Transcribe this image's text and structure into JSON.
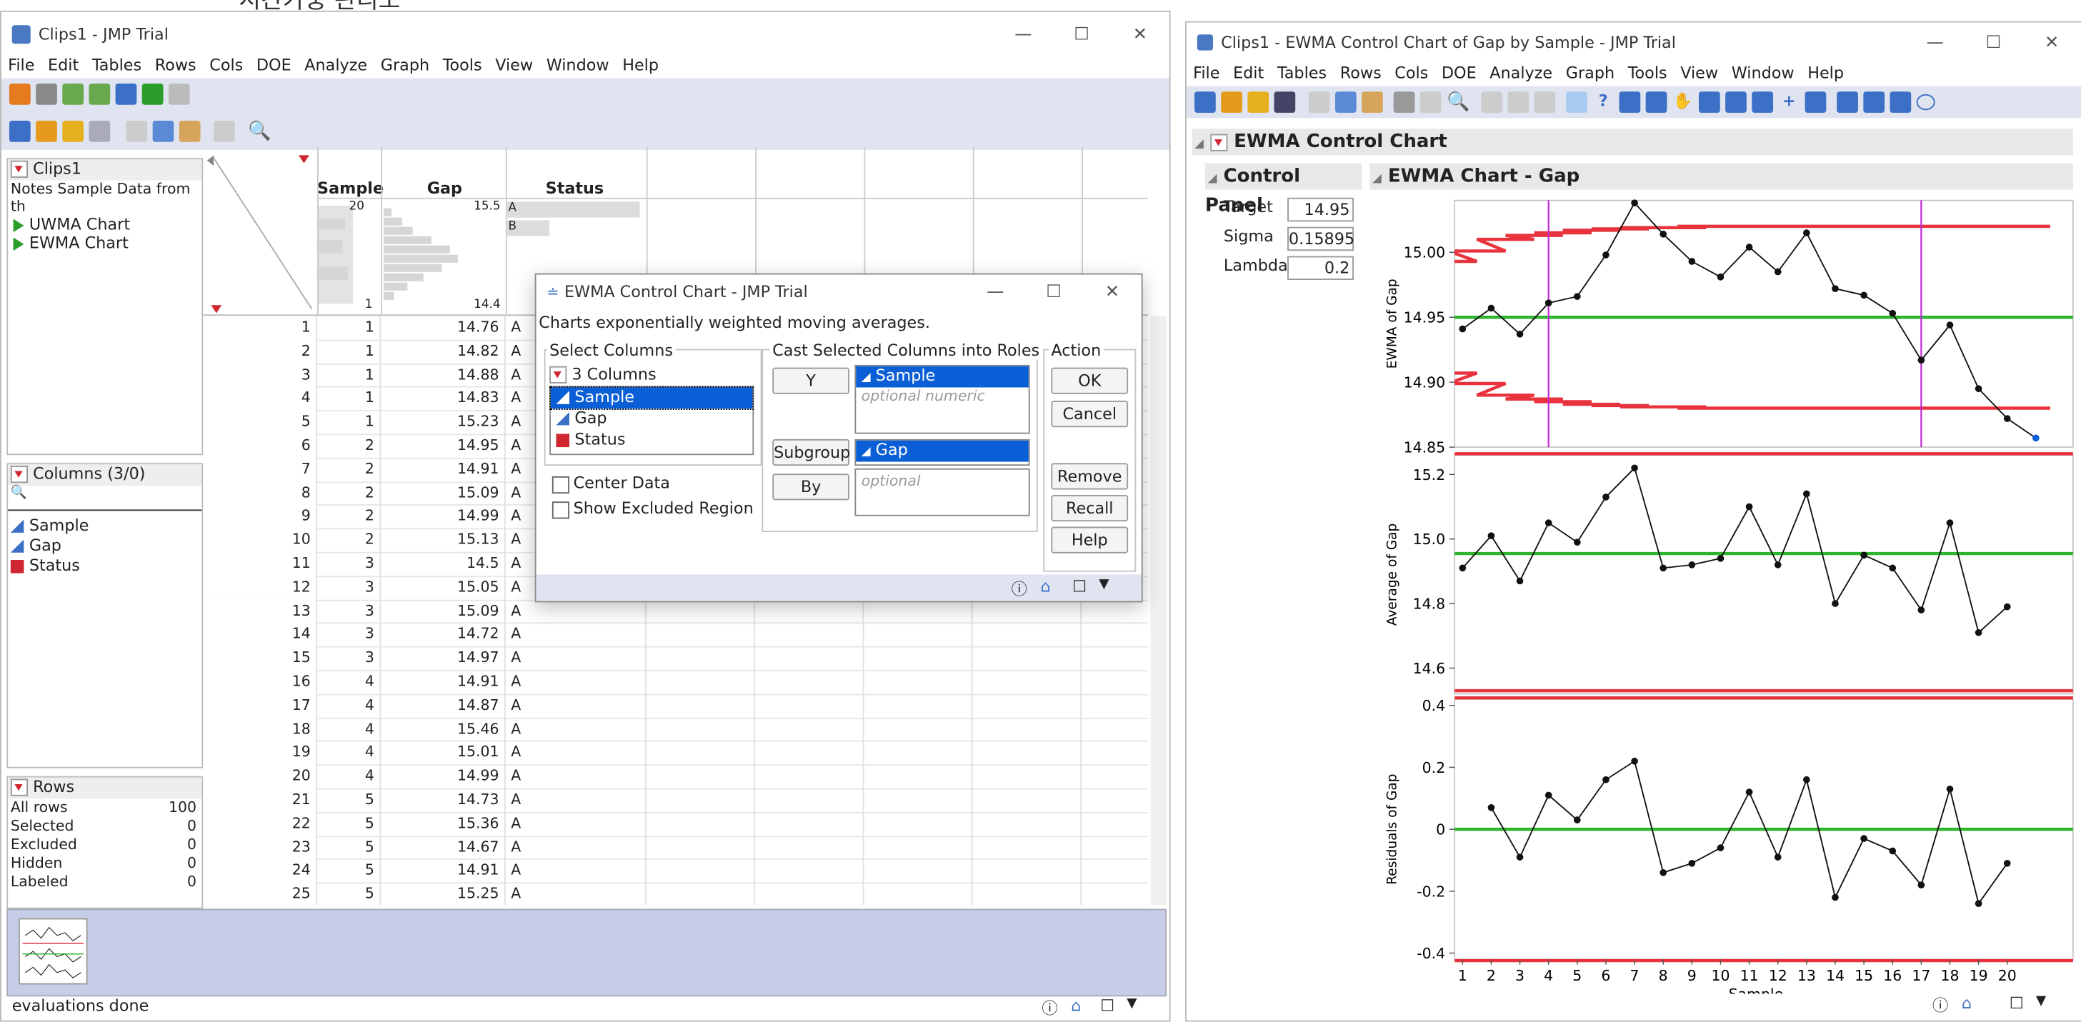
{
  "background_text": "시간가중 관리도",
  "left_window": {
    "title": "Clips1 - JMP Trial",
    "menus": [
      "File",
      "Edit",
      "Tables",
      "Rows",
      "Cols",
      "DOE",
      "Analyze",
      "Graph",
      "Tools",
      "View",
      "Window",
      "Help"
    ],
    "table_panel": {
      "name": "Clips1",
      "notes": "Notes  Sample Data from th",
      "scripts": [
        "UWMA Chart",
        "EWMA Chart"
      ]
    },
    "columns_panel": {
      "header": "Columns (3/0)",
      "search_placeholder": "",
      "columns": [
        "Sample",
        "Gap",
        "Status"
      ]
    },
    "rows_panel": {
      "header": "Rows",
      "items": [
        {
          "label": "All rows",
          "value": "100"
        },
        {
          "label": "Selected",
          "value": "0"
        },
        {
          "label": "Excluded",
          "value": "0"
        },
        {
          "label": "Hidden",
          "value": "0"
        },
        {
          "label": "Labeled",
          "value": "0"
        }
      ]
    },
    "grid": {
      "headers": [
        "Sample",
        "Gap",
        "Status"
      ],
      "summary": {
        "sample_max": "20",
        "sample_min": "1",
        "gap_max": "15.5",
        "gap_min": "14.4",
        "status_a": "A",
        "status_b": "B"
      },
      "rows": [
        [
          "1",
          "1",
          "14.76",
          "A"
        ],
        [
          "2",
          "1",
          "14.82",
          "A"
        ],
        [
          "3",
          "1",
          "14.88",
          "A"
        ],
        [
          "4",
          "1",
          "14.83",
          "A"
        ],
        [
          "5",
          "1",
          "15.23",
          "A"
        ],
        [
          "6",
          "2",
          "14.95",
          "A"
        ],
        [
          "7",
          "2",
          "14.91",
          "A"
        ],
        [
          "8",
          "2",
          "15.09",
          "A"
        ],
        [
          "9",
          "2",
          "14.99",
          "A"
        ],
        [
          "10",
          "2",
          "15.13",
          "A"
        ],
        [
          "11",
          "3",
          "14.5",
          "A"
        ],
        [
          "12",
          "3",
          "15.05",
          "A"
        ],
        [
          "13",
          "3",
          "15.09",
          "A"
        ],
        [
          "14",
          "3",
          "14.72",
          "A"
        ],
        [
          "15",
          "3",
          "14.97",
          "A"
        ],
        [
          "16",
          "4",
          "14.91",
          "A"
        ],
        [
          "17",
          "4",
          "14.87",
          "A"
        ],
        [
          "18",
          "4",
          "15.46",
          "A"
        ],
        [
          "19",
          "4",
          "15.01",
          "A"
        ],
        [
          "20",
          "4",
          "14.99",
          "A"
        ],
        [
          "21",
          "5",
          "14.73",
          "A"
        ],
        [
          "22",
          "5",
          "15.36",
          "A"
        ],
        [
          "23",
          "5",
          "14.67",
          "A"
        ],
        [
          "24",
          "5",
          "14.91",
          "A"
        ],
        [
          "25",
          "5",
          "15.25",
          "A"
        ]
      ]
    },
    "status": "evaluations done"
  },
  "dialog": {
    "title": "EWMA Control Chart - JMP Trial",
    "description": "Charts exponentially weighted moving averages.",
    "select_columns_label": "Select Columns",
    "columns_count": "3 Columns",
    "columns": [
      "Sample",
      "Gap",
      "Status"
    ],
    "cast_label": "Cast Selected Columns into Roles",
    "roles": {
      "y_button": "Y",
      "y_value": "Sample",
      "y_placeholder": "optional numeric",
      "subgroup_button": "Subgroup",
      "subgroup_value": "Gap",
      "by_button": "By",
      "by_placeholder": "optional"
    },
    "options": [
      "Center Data",
      "Show Excluded Region"
    ],
    "action_label": "Action",
    "buttons": [
      "OK",
      "Cancel",
      "Remove",
      "Recall",
      "Help"
    ]
  },
  "right_window": {
    "title": "Clips1 - EWMA Control Chart of Gap by Sample - JMP Trial",
    "menus": [
      "File",
      "Edit",
      "Tables",
      "Rows",
      "Cols",
      "DOE",
      "Analyze",
      "Graph",
      "Tools",
      "View",
      "Window",
      "Help"
    ],
    "report_title": "EWMA Control Chart",
    "control_panel_title": "Control Panel",
    "chart_title": "EWMA Chart - Gap",
    "params": [
      {
        "label": "Target",
        "value": "14.95"
      },
      {
        "label": "Sigma",
        "value": "0.15895"
      },
      {
        "label": "Lambda",
        "value": "0.2"
      }
    ]
  },
  "chart_data": [
    {
      "type": "line",
      "ylabel": "EWMA of Gap",
      "ylim": [
        14.85,
        15.04
      ],
      "yticks": [
        "15.00",
        "14.95",
        "14.90",
        "14.85"
      ],
      "x": [
        1,
        2,
        3,
        4,
        5,
        6,
        7,
        8,
        9,
        10,
        11,
        12,
        13,
        14,
        15,
        16,
        17,
        18,
        19,
        20
      ],
      "values": [
        14.941,
        14.957,
        14.937,
        14.961,
        14.966,
        14.998,
        15.038,
        15.014,
        14.993,
        14.981,
        15.004,
        14.985,
        15.015,
        14.972,
        14.967,
        14.953,
        14.917,
        14.944,
        14.895,
        14.872,
        14.857
      ],
      "center": 14.95,
      "ucl": [
        14.993,
        15.001,
        15.01,
        15.013,
        15.015,
        15.017,
        15.018,
        15.019,
        15.019,
        15.02,
        15.02,
        15.02,
        15.02,
        15.02,
        15.02,
        15.02,
        15.02,
        15.02,
        15.02,
        15.02,
        15.02
      ],
      "lcl": [
        14.907,
        14.899,
        14.89,
        14.887,
        14.885,
        14.883,
        14.882,
        14.881,
        14.881,
        14.88,
        14.88,
        14.88,
        14.88,
        14.88,
        14.88,
        14.88,
        14.88,
        14.88,
        14.88,
        14.88,
        14.88
      ],
      "markers_x": [
        4,
        17
      ]
    },
    {
      "type": "line",
      "ylabel": "Average of Gap",
      "ylim": [
        14.52,
        15.26
      ],
      "yticks": [
        "15.2",
        "15.0",
        "14.8",
        "14.6"
      ],
      "x": [
        1,
        2,
        3,
        4,
        5,
        6,
        7,
        8,
        9,
        10,
        11,
        12,
        13,
        14,
        15,
        16,
        17,
        18,
        19,
        20
      ],
      "values": [
        14.91,
        15.01,
        14.87,
        15.05,
        14.99,
        15.13,
        15.22,
        14.91,
        14.92,
        14.94,
        15.1,
        14.92,
        15.14,
        14.8,
        14.95,
        14.91,
        14.78,
        15.05,
        14.71,
        14.79
      ],
      "center": 14.955,
      "ucl": 15.55,
      "lcl": 14.53
    },
    {
      "type": "line",
      "ylabel": "Residuals of Gap",
      "ylim": [
        -0.42,
        0.42
      ],
      "yticks": [
        "0.4",
        "0.2",
        "0",
        "-0.2",
        "-0.4"
      ],
      "x": [
        2,
        3,
        4,
        5,
        6,
        7,
        8,
        9,
        10,
        11,
        12,
        13,
        14,
        15,
        16,
        17,
        18,
        19,
        20
      ],
      "values": [
        0.07,
        -0.09,
        0.11,
        0.03,
        0.16,
        0.22,
        -0.14,
        -0.11,
        -0.06,
        0.12,
        -0.09,
        0.16,
        -0.22,
        -0.03,
        -0.07,
        -0.18,
        0.13,
        -0.24,
        -0.11
      ],
      "center": 0,
      "ucl": 0.43,
      "lcl": -0.43,
      "xlabel": "Sample",
      "xticks": [
        "1",
        "2",
        "3",
        "4",
        "5",
        "6",
        "7",
        "8",
        "9",
        "10",
        "11",
        "12",
        "13",
        "14",
        "15",
        "16",
        "17",
        "18",
        "19",
        "20"
      ]
    }
  ],
  "colors": {
    "limit": "#e8333c",
    "center": "#2db52d",
    "marker": "#c02ad4",
    "selection": "#0a5fd6",
    "accent_panel": "#cfd5e9"
  }
}
